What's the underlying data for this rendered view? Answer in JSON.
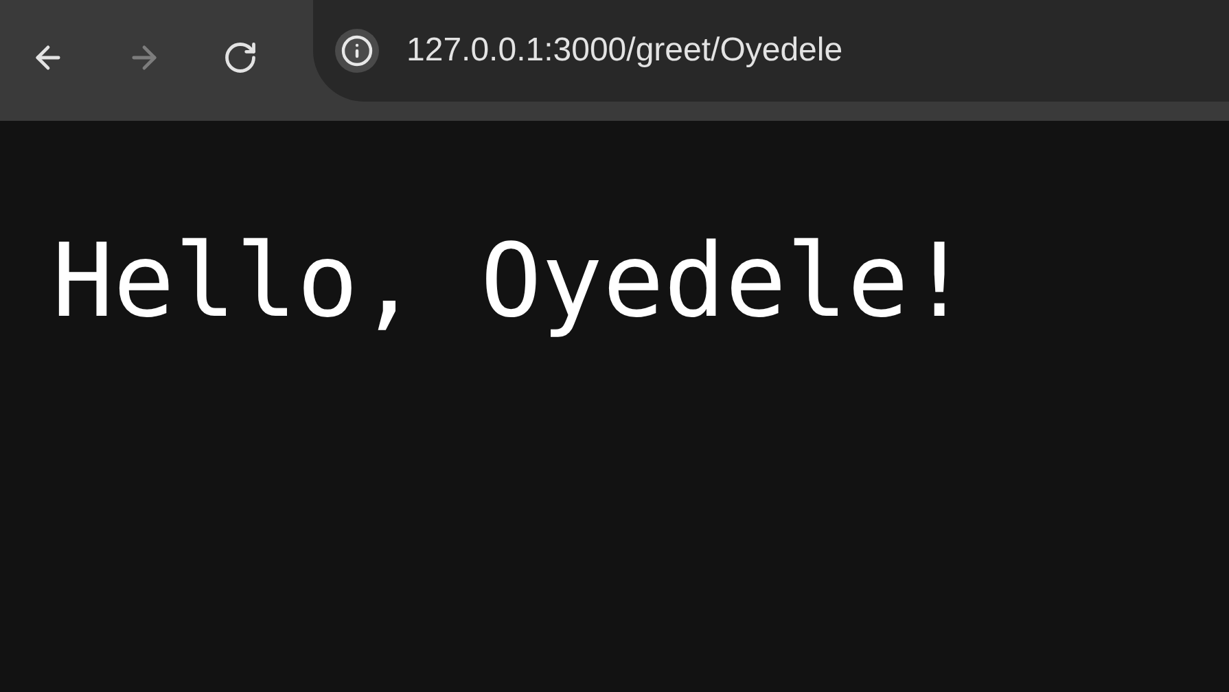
{
  "toolbar": {
    "buttons": [
      {
        "kind": "back",
        "disabled": false
      },
      {
        "kind": "forward",
        "disabled": true
      },
      {
        "kind": "reload",
        "disabled": false
      }
    ],
    "address": "127.0.0.1:3000/greet/Oyedele"
  },
  "page": {
    "heading": "Hello, Oyedele!"
  }
}
